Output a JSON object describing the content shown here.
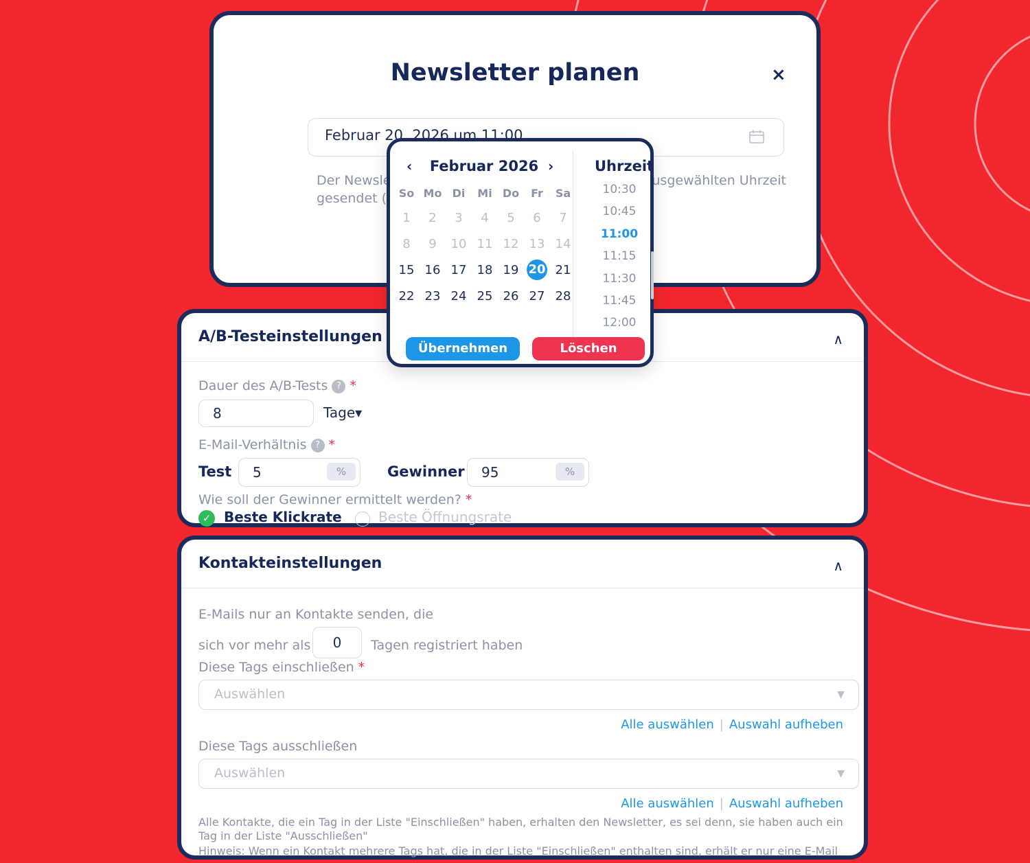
{
  "modal": {
    "title": "Newsletter planen",
    "close": "×",
    "date_value": "Februar 20, 2026 um 11:00",
    "help_line1": "Der Newsletter wird am ausgewählten Datum zur ausgewählten Uhrzeit",
    "help_line2": "gesendet (U"
  },
  "picker": {
    "prev": "‹",
    "next": "›",
    "month": "Februar 2026",
    "weekdays": [
      "So",
      "Mo",
      "Di",
      "Mi",
      "Do",
      "Fr",
      "Sa"
    ],
    "week1": [
      "1",
      "2",
      "3",
      "4",
      "5",
      "6",
      "7"
    ],
    "week2": [
      "8",
      "9",
      "10",
      "11",
      "12",
      "13",
      "14"
    ],
    "week3": [
      "15",
      "16",
      "17",
      "18",
      "19",
      "20",
      "21"
    ],
    "week4": [
      "22",
      "23",
      "24",
      "25",
      "26",
      "27",
      "28"
    ],
    "selected_day": "20",
    "time_title": "Uhrzeit",
    "times": [
      "10:30",
      "10:45",
      "11:00",
      "11:15",
      "11:30",
      "11:45",
      "12:00"
    ],
    "selected_time": "11:00",
    "apply": "Übernehmen",
    "clear": "Löschen"
  },
  "ab_panel": {
    "title": "A/B-Testeinstellungen",
    "caret": "∧",
    "duration_label": "Dauer des A/B-Tests",
    "help": "?",
    "required": "*",
    "duration_value": "8",
    "duration_unit": "Tage▾",
    "ratio_label": "E-Mail-Verhältnis",
    "test_label": "Test",
    "test_value": "5",
    "percent": "%",
    "winner_label": "Gewinner",
    "winner_value": "95",
    "question": "Wie soll der Gewinner ermittelt werden?",
    "option_checked": "Beste Klickrate",
    "option_unchecked": "Beste Öffnungsrate",
    "check": "✓"
  },
  "contact_panel": {
    "title": "Kontakteinstellungen",
    "caret": "∧",
    "send_only": "E-Mails nur an Kontakte senden, die",
    "reg_prefix": "sich vor mehr als",
    "reg_days": "0",
    "reg_suffix": "Tagen registriert haben",
    "include_label": "Diese Tags einschließen",
    "required": "*",
    "select_placeholder": "Auswählen",
    "arrow": "▼",
    "select_all": "Alle auswählen",
    "separator": "|",
    "deselect": "Auswahl aufheben",
    "exclude_label": "Diese Tags ausschließen",
    "note1": "Alle Kontakte, die ein Tag in der Liste \"Einschließen\" haben, erhalten den Newsletter, es sei denn, sie haben auch ein Tag in der Liste \"Ausschließen\"",
    "note2": "Hinweis: Wenn ein Kontakt mehrere Tags hat, die in der Liste \"Einschließen\" enthalten sind, erhält er nur eine E-Mail"
  },
  "colors": {
    "background": "#f2272d",
    "navy": "#1a2b5c",
    "accent_blue": "#1e96e6",
    "danger": "#f0334e",
    "success": "#2dbd5a"
  }
}
